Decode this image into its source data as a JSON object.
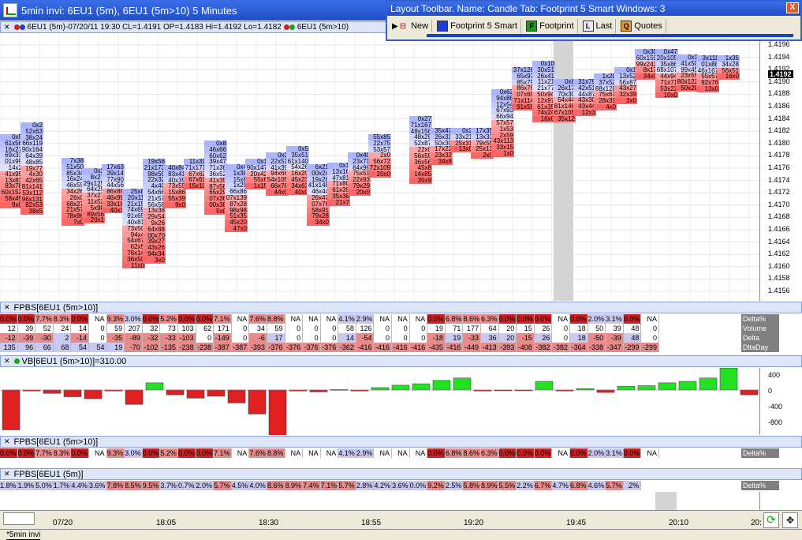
{
  "window": {
    "title": "5min invi: 6EU1 (5m), 6EU1 (5m>10) 5 Minutes",
    "min": "_",
    "max": "□",
    "close": "X"
  },
  "layout_toolbar": {
    "title": "Layout Toolbar. Name: Candle  Tab: Footprint 5 Smart  Windows: 3",
    "close": "X",
    "buttons": [
      {
        "label": "New",
        "icon": "new-icon",
        "color": "#ece9d8"
      },
      {
        "label": "Footprint 5 Smart",
        "icon": "blue-square-icon",
        "color": "#1c3cd8"
      },
      {
        "label": "Footprint",
        "icon": "F",
        "color": "#1a9a1a"
      },
      {
        "label": "Last",
        "icon": "L",
        "color": "#e8e8f8"
      },
      {
        "label": "Quotes",
        "icon": "Q",
        "color": "#e89a30"
      }
    ]
  },
  "chart_bar": {
    "label": "6EU1 (5m)-07/20/11 19:30  CL=1.4191  OP=1.4183  Hi=1.4192  Lo=1.4182",
    "label2": "6EU1 (5m>10)"
  },
  "price_axis": {
    "labels": [
      "1.4196",
      "1.4194",
      "1.4192",
      "1.4190",
      "1.4188",
      "1.4186",
      "1.4184",
      "1.4182",
      "1.4180",
      "1.4178",
      "1.4176",
      "1.4174",
      "1.4172",
      "1.4170",
      "1.4168",
      "1.4166",
      "1.4164",
      "1.4162",
      "1.4160",
      "1.4158",
      "1.4156"
    ],
    "current": "1.4192"
  },
  "fpbs1": {
    "label": "FPBS[6EU1 (5m>10)]",
    "delta_pct": [
      "0.0%",
      "0.0%",
      "7.7%",
      "8.3%",
      "0.0%",
      "NA",
      "9.3%",
      "3.0%",
      "0.0%",
      "5.2%",
      "0.0%",
      "0.0%",
      "7.1%",
      "NA",
      "7.6%",
      "8.8%",
      "NA",
      "NA",
      "NA",
      "4.1%",
      "2.9%",
      "NA",
      "NA",
      "NA",
      "0.0%",
      "6.8%",
      "8.6%",
      "6.3%",
      "0.0%",
      "0.0%",
      "0.0%",
      "NA",
      "0.0%",
      "2.0%",
      "3.1%",
      "0.0%",
      "NA"
    ],
    "volume": [
      "12",
      "39",
      "52",
      "24",
      "14",
      "0",
      "59",
      "207",
      "32",
      "73",
      "103",
      "62",
      "171",
      "0",
      "34",
      "59",
      "0",
      "0",
      "0",
      "58",
      "126",
      "0",
      "0",
      "0",
      "19",
      "71",
      "177",
      "64",
      "20",
      "15",
      "26",
      "0",
      "18",
      "50",
      "39",
      "48",
      "0"
    ],
    "delta": [
      "-12",
      "-39",
      "-30",
      "2",
      "-14",
      "0",
      "-35",
      "-89",
      "-32",
      "-33",
      "-103",
      "0",
      "-149",
      "0",
      "-6",
      "17",
      "0",
      "0",
      "0",
      "14",
      "-54",
      "0",
      "0",
      "0",
      "-18",
      "19",
      "-33",
      "36",
      "20",
      "-15",
      "26",
      "0",
      "18",
      "-50",
      "-39",
      "48",
      "0"
    ],
    "dltaday": [
      "135",
      "96",
      "66",
      "68",
      "54",
      "54",
      "19",
      "-70",
      "-102",
      "-135",
      "-238",
      "-238",
      "-387",
      "-387",
      "-393",
      "-376",
      "-376",
      "-376",
      "-376",
      "-362",
      "-416",
      "-416",
      "-416",
      "-416",
      "-435",
      "-416",
      "-449",
      "-413",
      "-393",
      "-408",
      "-382",
      "-382",
      "-364",
      "-338",
      "-347",
      "-299",
      "-299"
    ],
    "labels": [
      "Delta%",
      "Volume",
      "Delta",
      "DltaDay"
    ],
    "last": "NA",
    "last_day": "-299"
  },
  "vb": {
    "label": "VB[6EU1 (5m>10)]=310.00",
    "values": [
      -830,
      -20,
      -70,
      -140,
      -180,
      -20,
      -300,
      150,
      -100,
      -170,
      -130,
      -270,
      -500,
      -1000,
      -20,
      -40,
      10,
      -20,
      50,
      100,
      130,
      200,
      250,
      -20,
      0,
      0,
      180,
      -20,
      30,
      -50,
      80,
      90,
      150,
      180,
      250,
      460,
      -100,
      150,
      180,
      230,
      180
    ],
    "axis": [
      "400",
      "0",
      "-400",
      "-800"
    ]
  },
  "fpbs2": {
    "label": "FPBS[6EU1 (5m>10)]",
    "delta_pct": [
      "0.0%",
      "0.0%",
      "7.7%",
      "8.3%",
      "0.0%",
      "NA",
      "9.3%",
      "3.0%",
      "0.0%",
      "5.2%",
      "0.0%",
      "0.0%",
      "7.1%",
      "NA",
      "7.6%",
      "8.8%",
      "NA",
      "NA",
      "NA",
      "4.1%",
      "2.9%",
      "NA",
      "NA",
      "NA",
      "0.0%",
      "6.8%",
      "8.6%",
      "6.3%",
      "0.0%",
      "0.0%",
      "0.0%",
      "NA",
      "0.0%",
      "2.0%",
      "3.1%",
      "0.0%",
      "NA"
    ],
    "row_label": "Delta%"
  },
  "fpbs3": {
    "label": "FPBS[6EU1 (5m)]",
    "delta_pct": [
      "1.8%",
      "1.9%",
      "5.0%",
      "1.7%",
      "4.4%",
      "3.6%",
      "7.8%",
      "8.5%",
      "9.5%",
      "3.7%",
      "0.7%",
      "2.0%",
      "5.7%",
      "4.5%",
      "4.0%",
      "8.6%",
      "8.9%",
      "7.4%",
      "7.1%",
      "5.7%",
      "2.8%",
      "4.2%",
      "3.6%",
      "0.0%",
      "9.2%",
      "2.5%",
      "5.8%",
      "8.9%",
      "5.5%",
      "2.2%",
      "6.7%",
      "4.7%",
      "6.8%",
      "4.6%",
      "5.7%",
      ".2%"
    ],
    "row_label": "Delta%"
  },
  "time_axis": [
    "07/20",
    "18:05",
    "18:30",
    "18:55",
    "19:20",
    "19:45",
    "20:10",
    "20:"
  ],
  "status_tab": "*5min invi",
  "footprint_cols": [
    [
      "0x5",
      "61x56",
      "16x27",
      "69x33",
      "01x99",
      "14x2",
      "41x95",
      "13x83",
      "83x78",
      "60x152",
      "58x45",
      "9x0"
    ],
    [
      "0x2",
      "52x63",
      "38x24",
      "66x119",
      "90x164",
      "64x39",
      "48x85",
      "19x77",
      "4x30",
      "42x65",
      "81x141",
      "53x112",
      "96x131",
      "82x53",
      "38x5"
    ],
    [
      "7x38",
      "51x50",
      "85x34",
      "16x24",
      "46x59",
      "34x26",
      "26x0",
      "68x27",
      "21x57",
      "78x96",
      "7x0"
    ],
    [
      "0x2",
      "8x27",
      "29x125",
      "64x25",
      "37x27",
      "11x52",
      "5x98",
      "89x56",
      "20x1"
    ],
    [
      "17x63",
      "39x14",
      "77x90",
      "44x56",
      "86x86",
      "46x99",
      "33x18",
      "40x3"
    ],
    [
      "25x8",
      "20x11",
      "21x15",
      "74x69",
      "91x65",
      "40x81",
      "73x50",
      "94x4",
      "54x67",
      "62x5",
      "76x14",
      "36x50",
      "11x0"
    ],
    [
      "19x56",
      "21x173",
      "98x59",
      "22x32",
      "4x40",
      "54x66",
      "21x57",
      "56x58",
      "13x38",
      "29x54",
      "9x26",
      "64x88",
      "00x70",
      "39x27",
      "43x26",
      "94x34",
      "3x0"
    ],
    [
      "40x84",
      "83x41",
      "40x39",
      "73x55",
      "15x86",
      "55x39",
      "9x0"
    ],
    [
      "11x31",
      "71x171",
      "67x62",
      "67x61",
      "15x10"
    ],
    [
      "0x8",
      "46x66",
      "60x62",
      "39x47",
      "71x38",
      "36x52",
      "41x35",
      "87x58",
      "65x29",
      "07x36",
      "00x38",
      "5x0"
    ],
    [
      "0x4",
      "1x38",
      "15x8",
      "1x29",
      "66x86",
      "07x139",
      "87x28",
      "98x98",
      "51x35",
      "45x20",
      "47x0"
    ],
    [
      "0x1",
      "90x147",
      "20x42",
      "55x6",
      "1x15"
    ],
    [
      "0x3",
      "22x51",
      "41x39",
      "94x66",
      "54x105",
      "66x76",
      "44x0"
    ],
    [
      "0x5",
      "35x51",
      "61x140",
      "54x26",
      "16x20",
      "45x23",
      "34x63",
      "40x0"
    ],
    [
      "6x21",
      "00x24",
      "19x26",
      "41x148",
      "46x44",
      "26x47",
      "07x76",
      "58x91",
      "79x28",
      "34x0"
    ],
    [
      "0x1",
      "13x16",
      "47x81",
      "71x80",
      "61x39",
      "35x38",
      "21x7"
    ],
    [
      "0x40",
      "23x71",
      "64x96",
      "75x51",
      "22x93",
      "79x29",
      "20x0"
    ],
    [
      "55x85",
      "22x75",
      "53x57",
      "2x0",
      "56x72",
      "72x109",
      "20x0"
    ],
    [
      "0x27",
      "71x167",
      "48x156",
      "48x29",
      "52x87",
      "22x0",
      "56x59",
      "36x56",
      "45x8",
      "14x85",
      "35x9"
    ],
    [
      "35x47",
      "26x31",
      "50x30",
      "17x22",
      "23x32",
      "34x8"
    ],
    [
      "0x2",
      "33x21",
      "25x31",
      "13x0"
    ],
    [
      "17x35",
      "13x33",
      "79x55",
      "25x13",
      "2x0"
    ],
    [
      "0x62",
      "94x86",
      "12x54",
      "67x93",
      "66x94",
      "57x57",
      "1x53",
      "2x59",
      "43x113",
      "33x15",
      "1x0"
    ],
    [
      "37x126",
      "65x97",
      "85x79",
      "86x76",
      "07x60",
      "71x114",
      "91x59"
    ],
    [
      "0x10",
      "30x51",
      "26x41",
      "11x21",
      "21x77",
      "50x94",
      "12x97",
      "61x35",
      "74x24",
      "16x0"
    ],
    [
      "0x6",
      "26x17",
      "70x30",
      "54x44",
      "81x148",
      "67x105",
      "35x12"
    ],
    [
      "31x79",
      "42x51",
      "44x87",
      "43x30",
      "43x44",
      "12x3"
    ],
    [
      "1x20",
      "37x52",
      "88x128",
      "75x67",
      "28x31",
      "4x0"
    ],
    [
      "0x1",
      "13x52",
      "56x87",
      "43x27",
      "32x39",
      "3x0"
    ],
    [
      "0x30",
      "60x159",
      "99x243",
      "8x17",
      "34x0"
    ],
    [
      "0x47",
      "20x105",
      "35x86",
      "68x107",
      "44x94",
      "71x71",
      "53x22",
      "10x0"
    ],
    [
      "0x1",
      "41x50",
      "99x45",
      "23x55",
      "80x122",
      "50x20"
    ],
    [
      "3x111",
      "01x88",
      "46x167",
      "55x57",
      "92x76",
      "13x0"
    ],
    [
      "1x35",
      "34x28",
      "56x51",
      "16x0"
    ]
  ]
}
